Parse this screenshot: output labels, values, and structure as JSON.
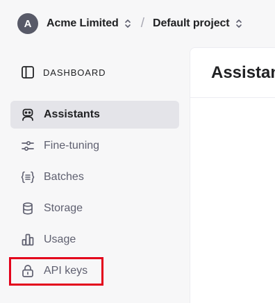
{
  "header": {
    "org": {
      "avatar_letter": "A",
      "name": "Acme Limited"
    },
    "separator": "/",
    "project": {
      "name": "Default project"
    }
  },
  "sidebar": {
    "dashboard_label": "DASHBOARD",
    "items": [
      {
        "label": "Assistants",
        "icon": "robot-icon",
        "active": true
      },
      {
        "label": "Fine-tuning",
        "icon": "sliders-icon",
        "active": false
      },
      {
        "label": "Batches",
        "icon": "braces-list-icon",
        "active": false
      },
      {
        "label": "Storage",
        "icon": "database-icon",
        "active": false
      },
      {
        "label": "Usage",
        "icon": "bar-chart-icon",
        "active": false
      },
      {
        "label": "API keys",
        "icon": "lock-icon",
        "active": false,
        "highlighted": true
      }
    ]
  },
  "main": {
    "title": "Assistants"
  },
  "colors": {
    "highlight_border": "#e3001b",
    "active_item_bg": "#e4e4e9",
    "avatar_bg": "#585a68"
  }
}
